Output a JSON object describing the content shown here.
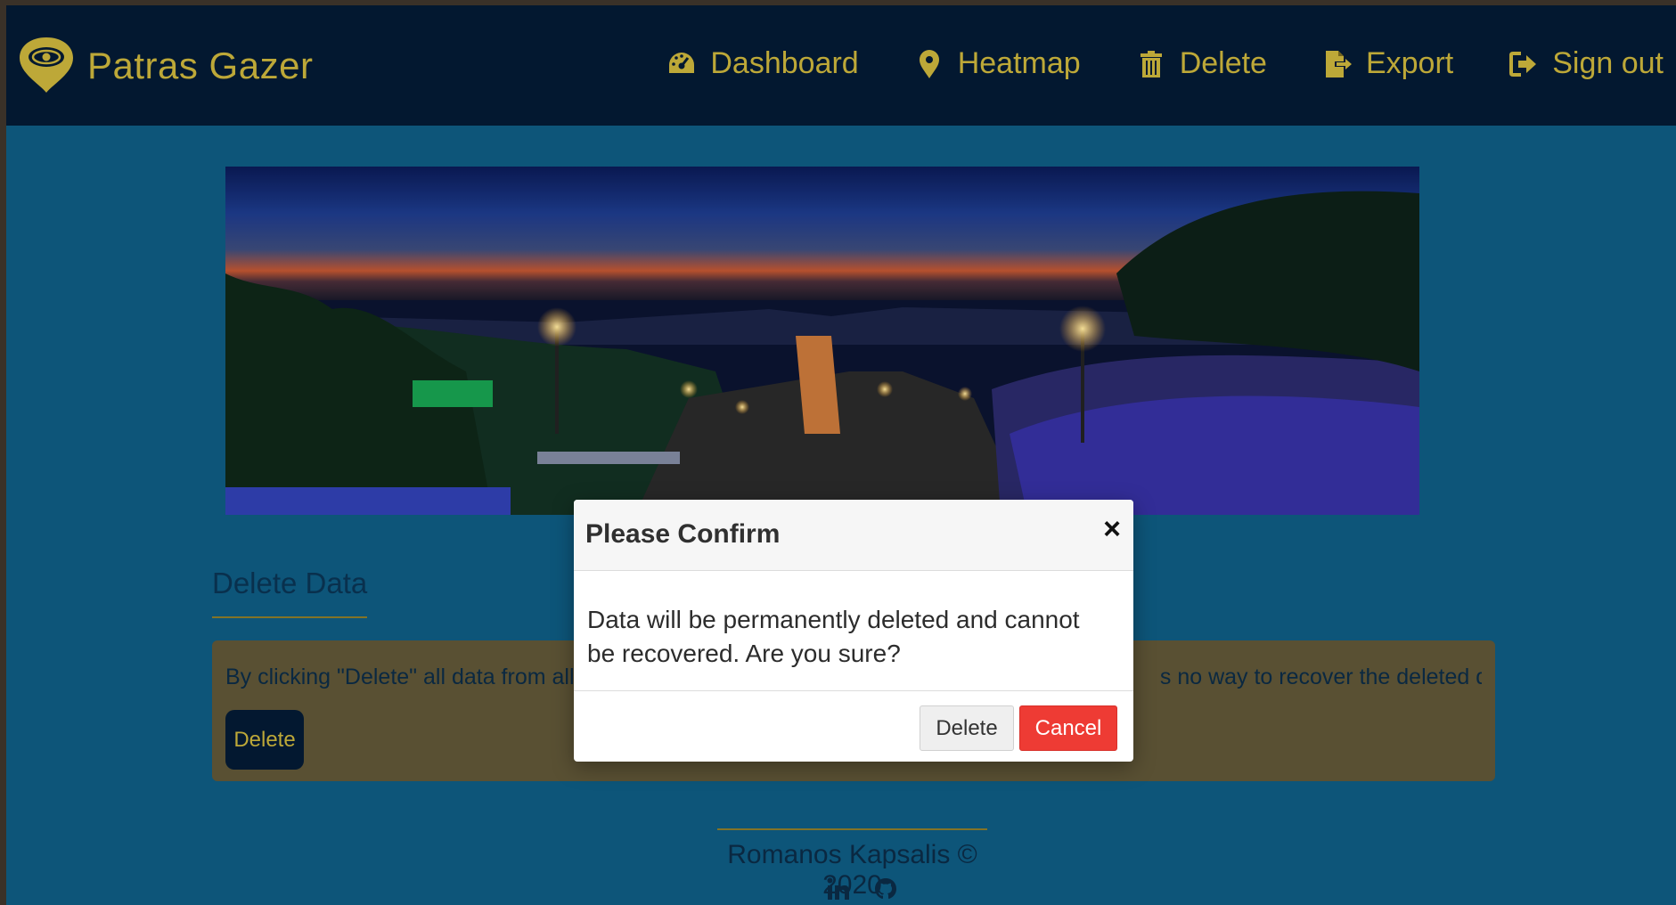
{
  "brand": {
    "name": "Patras Gazer",
    "logo_icon": "eye-pin-icon"
  },
  "nav": {
    "dashboard": "Dashboard",
    "heatmap": "Heatmap",
    "delete": "Delete",
    "export": "Export",
    "signout": "Sign out"
  },
  "section": {
    "title": "Delete Data",
    "alert_text_left": "By clicking \"Delete\" all data from all us",
    "alert_text_right": "s no way to recover the deleted data.",
    "delete_button": "Delete"
  },
  "footer": {
    "text": "Romanos Kapsalis © 2020",
    "icons": [
      "linkedin-icon",
      "github-icon"
    ]
  },
  "modal": {
    "title": "Please Confirm",
    "close": "×",
    "body": "Data will be permanently deleted and cannot be recovered. Are you sure?",
    "delete_label": "Delete",
    "cancel_label": "Cancel"
  },
  "colors": {
    "navbar": "#041a33",
    "accent_gold": "#c8b13b",
    "page_bg": "#0e5a80",
    "alert_bg": "#5e5536",
    "cancel_red": "#ee3b34"
  }
}
